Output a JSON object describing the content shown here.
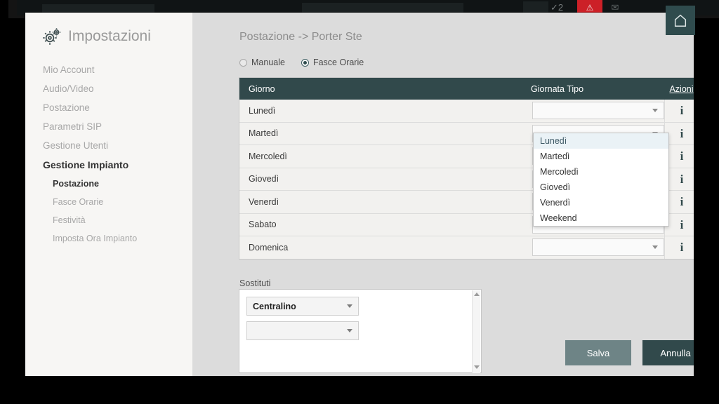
{
  "background": {
    "check_badge": "✓2",
    "warning_badge": "⚠",
    "mail_icon": "✉"
  },
  "home_button": {
    "icon": "home-icon",
    "label": ""
  },
  "sidebar": {
    "title": "Impostazioni",
    "gear_icon": "gear-icon",
    "items": [
      {
        "label": "Mio Account",
        "bold": false,
        "sub": false
      },
      {
        "label": "Audio/Video",
        "bold": false,
        "sub": false
      },
      {
        "label": "Postazione",
        "bold": false,
        "sub": false
      },
      {
        "label": "Parametri SIP",
        "bold": false,
        "sub": false
      },
      {
        "label": "Gestione Utenti",
        "bold": false,
        "sub": false
      },
      {
        "label": "Gestione Impianto",
        "bold": true,
        "sub": false
      },
      {
        "label": "Postazione",
        "bold": true,
        "sub": true
      },
      {
        "label": "Fasce Orarie",
        "bold": false,
        "sub": true
      },
      {
        "label": "Festività",
        "bold": false,
        "sub": true
      },
      {
        "label": "Imposta Ora Impianto",
        "bold": false,
        "sub": true
      }
    ]
  },
  "main": {
    "breadcrumb": "Postazione -> Porter Ste",
    "mode_options": [
      {
        "label": "Manuale",
        "selected": false
      },
      {
        "label": "Fasce Orarie",
        "selected": true
      }
    ],
    "table": {
      "headers": {
        "day": "Giorno",
        "type": "Giornata Tipo",
        "actions": "Azioni"
      },
      "info_icon": "i",
      "rows": [
        {
          "day": "Lunedì",
          "type": ""
        },
        {
          "day": "Martedì",
          "type": ""
        },
        {
          "day": "Mercoledì",
          "type": ""
        },
        {
          "day": "Giovedì",
          "type": ""
        },
        {
          "day": "Venerdì",
          "type": ""
        },
        {
          "day": "Sabato",
          "type": ""
        },
        {
          "day": "Domenica",
          "type": ""
        }
      ]
    },
    "open_dropdown": {
      "row_index": 0,
      "options": [
        {
          "label": "Lunedì",
          "highlighted": true
        },
        {
          "label": "Martedì",
          "highlighted": false
        },
        {
          "label": "Mercoledì",
          "highlighted": false
        },
        {
          "label": "Giovedì",
          "highlighted": false
        },
        {
          "label": "Venerdì",
          "highlighted": false
        },
        {
          "label": "Weekend",
          "highlighted": false
        }
      ]
    },
    "sostituti": {
      "label": "Sostituti",
      "selects": [
        {
          "value": "Centralino"
        },
        {
          "value": ""
        }
      ]
    },
    "buttons": {
      "save": "Salva",
      "cancel": "Annulla"
    }
  },
  "colors": {
    "accent_dark": "#31494b",
    "save_button": "#6e8486",
    "panel_bg": "#dcdcdc",
    "sidebar_bg": "#f7f6f4",
    "highlight": "#eaf2f6"
  }
}
